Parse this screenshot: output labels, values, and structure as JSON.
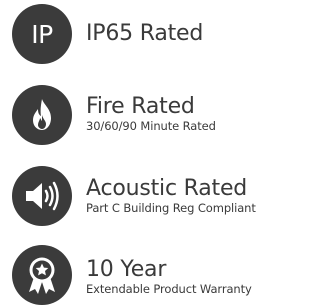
{
  "features": [
    {
      "icon": "ip-icon",
      "icon_text": "IP",
      "title": "IP65 Rated",
      "subtitle": ""
    },
    {
      "icon": "flame-icon",
      "title": "Fire Rated",
      "subtitle": "30/60/90 Minute Rated"
    },
    {
      "icon": "speaker-icon",
      "title": "Acoustic Rated",
      "subtitle": "Part C Building Reg Compliant"
    },
    {
      "icon": "award-ribbon-icon",
      "title": "10 Year",
      "subtitle": "Extendable Product Warranty"
    }
  ],
  "colors": {
    "badge": "#3b3b3b",
    "icon_fg": "#ffffff",
    "text": "#3a3a3a"
  }
}
